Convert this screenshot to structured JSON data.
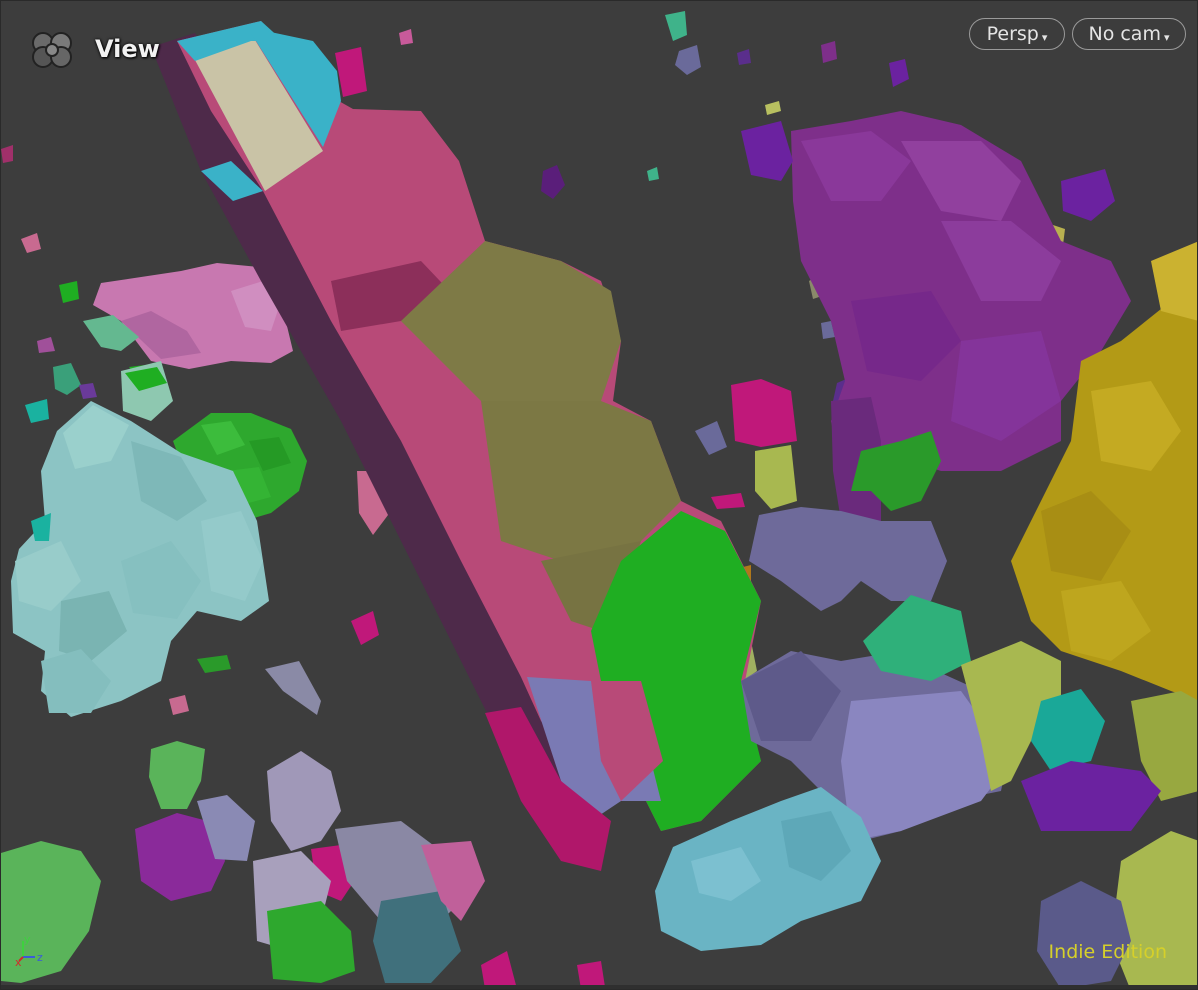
{
  "viewport": {
    "title": "View",
    "icon": "scene-view-icon"
  },
  "toolbar": {
    "projection_label": "Persp",
    "camera_label": "No cam"
  },
  "watermark": {
    "edition_label": "Indie Edition"
  },
  "axis": {
    "y_label": "y",
    "x_label": "x",
    "z_label": "z",
    "colors": {
      "x": "#d12b2b",
      "y": "#3ed13e",
      "z": "#3b5bd9"
    }
  },
  "scene_colors": {
    "background": "#3d3d3d",
    "pink": "#b44a78",
    "olive": "#7e7a46",
    "green": "#1fae22",
    "purple": "#7e2f8a",
    "yellow": "#b39a16",
    "light_blue": "#88bcbc",
    "slate": "#6e6a9a",
    "cyan": "#3ab2c8",
    "magenta": "#b0176a"
  }
}
